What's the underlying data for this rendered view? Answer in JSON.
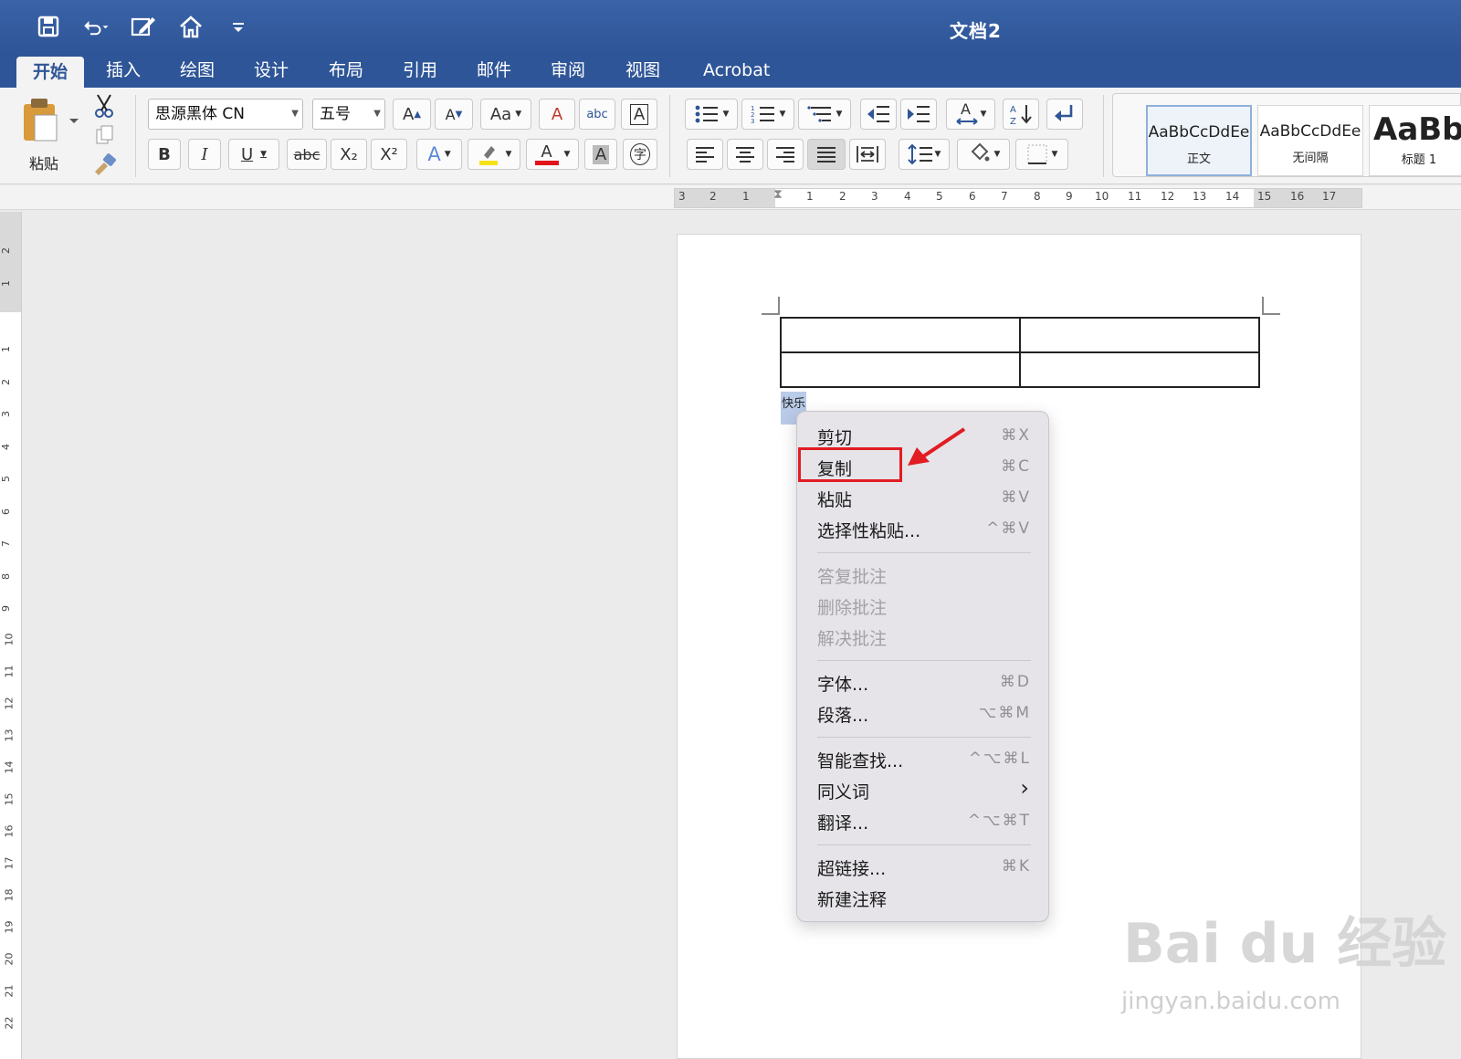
{
  "window": {
    "title": "文档2"
  },
  "qat": [
    {
      "icon": "save-icon"
    },
    {
      "icon": "undo-icon"
    },
    {
      "icon": "edit-doc-icon"
    },
    {
      "icon": "home-icon"
    },
    {
      "icon": "customize-icon"
    }
  ],
  "tabs": [
    "开始",
    "插入",
    "绘图",
    "设计",
    "布局",
    "引用",
    "邮件",
    "审阅",
    "视图",
    "Acrobat"
  ],
  "ribbon": {
    "paste_label": "粘贴",
    "font_name": "思源黑体 CN",
    "font_size": "五号",
    "bold": "B",
    "italic": "I",
    "underline": "U",
    "strike": "abc",
    "subscript": "X₂",
    "superscript": "X²",
    "grow": "A",
    "shrink": "A",
    "change_case": "Aa",
    "clear": "A",
    "phonetic": "abc",
    "char_border": "A",
    "text_effect": "A",
    "font_color": "A",
    "char_shade": "A",
    "enclose": "字",
    "styles": [
      {
        "sample": "AaBbCcDdEe",
        "name": "正文"
      },
      {
        "sample": "AaBbCcDdEe",
        "name": "无间隔"
      },
      {
        "sample": "AaBb",
        "name": "标题 1"
      }
    ]
  },
  "ruler": {
    "h_left": [
      "3",
      "2",
      "1"
    ],
    "h_right": [
      "1",
      "2",
      "3",
      "4",
      "5",
      "6",
      "7",
      "8",
      "9",
      "10",
      "11",
      "12",
      "13",
      "14",
      "15",
      "16",
      "17"
    ],
    "v_top": [
      "2",
      "1"
    ],
    "v": [
      "1",
      "2",
      "3",
      "4",
      "5",
      "6",
      "7",
      "8",
      "9",
      "10",
      "11",
      "12",
      "13",
      "14",
      "15",
      "16",
      "17",
      "18",
      "19",
      "20",
      "21",
      "22"
    ]
  },
  "document": {
    "selected_text": "快乐"
  },
  "context_menu": {
    "groups": [
      [
        {
          "label": "剪切",
          "shortcut": "⌘X",
          "enabled": true
        },
        {
          "label": "复制",
          "shortcut": "⌘C",
          "enabled": true
        },
        {
          "label": "粘贴",
          "shortcut": "⌘V",
          "enabled": true
        },
        {
          "label": "选择性粘贴...",
          "shortcut": "^⌘V",
          "enabled": true
        }
      ],
      [
        {
          "label": "答复批注",
          "shortcut": "",
          "enabled": false
        },
        {
          "label": "删除批注",
          "shortcut": "",
          "enabled": false
        },
        {
          "label": "解决批注",
          "shortcut": "",
          "enabled": false
        }
      ],
      [
        {
          "label": "字体...",
          "shortcut": "⌘D",
          "enabled": true
        },
        {
          "label": "段落...",
          "shortcut": "⌥⌘M",
          "enabled": true
        }
      ],
      [
        {
          "label": "智能查找...",
          "shortcut": "^⌥⌘L",
          "enabled": true
        },
        {
          "label": "同义词",
          "shortcut": "›",
          "enabled": true
        },
        {
          "label": "翻译...",
          "shortcut": "^⌥⌘T",
          "enabled": true
        }
      ],
      [
        {
          "label": "超链接...",
          "shortcut": "⌘K",
          "enabled": true
        },
        {
          "label": "新建注释",
          "shortcut": "",
          "enabled": true
        }
      ]
    ]
  },
  "watermark": {
    "brand": "Bai du 经验",
    "url": "jingyan.baidu.com"
  },
  "colors": {
    "accent": "#2e5597",
    "highlight_box": "#e11c22"
  }
}
